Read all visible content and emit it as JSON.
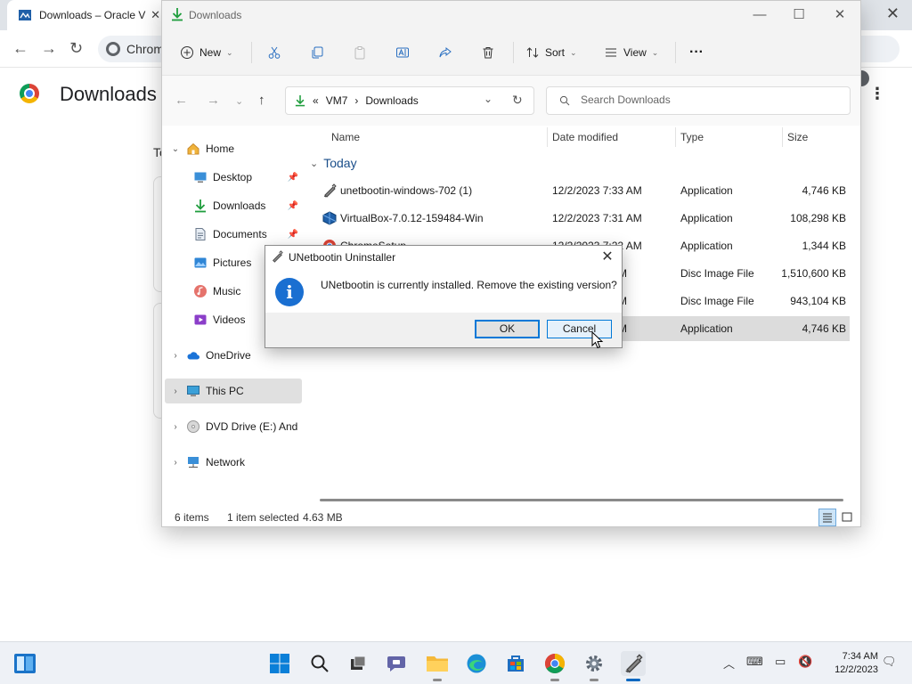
{
  "chrome": {
    "tab_title": "Downloads – Oracle V",
    "omnibox_text": "Chrom",
    "page_title": "Downloads",
    "partial_text": "To"
  },
  "explorer": {
    "title": "Downloads",
    "commands": {
      "new": "New",
      "sort": "Sort",
      "view": "View",
      "more": "···"
    },
    "address": {
      "overflow": "«",
      "crumbs": [
        "VM7",
        "Downloads"
      ],
      "sep": "›"
    },
    "search_placeholder": "Search Downloads",
    "nav": [
      {
        "label": "Home",
        "expand": "⌄"
      },
      {
        "label": "Desktop",
        "pinned": "📌"
      },
      {
        "label": "Downloads",
        "pinned": "📌"
      },
      {
        "label": "Documents",
        "pinned": "📌"
      },
      {
        "label": "Pictures",
        "pinned": "📌"
      },
      {
        "label": "Music"
      },
      {
        "label": "Videos"
      },
      {
        "label": "OneDrive",
        "expand": "›"
      },
      {
        "label": "This PC",
        "expand": "›"
      },
      {
        "label": "DVD Drive (E:) Andro",
        "expand": "›"
      },
      {
        "label": "Network",
        "expand": "›"
      }
    ],
    "columns": [
      "Name",
      "Date modified",
      "Type",
      "Size"
    ],
    "group": "Today",
    "files": [
      {
        "name": "unetbootin-windows-702 (1)",
        "date": "12/2/2023 7:33 AM",
        "type": "Application",
        "size": "4,746 KB"
      },
      {
        "name": "VirtualBox-7.0.12-159484-Win",
        "date": "12/2/2023 7:31 AM",
        "type": "Application",
        "size": "108,298 KB"
      },
      {
        "name": "ChromeSetup",
        "date": "12/2/2023 7:22 AM",
        "type": "Application",
        "size": "1,344 KB"
      },
      {
        "name": "",
        "date": "AM",
        "type": "Disc Image File",
        "size": "1,510,600 KB"
      },
      {
        "name": "",
        "date": "AM",
        "type": "Disc Image File",
        "size": "943,104 KB"
      },
      {
        "name": "",
        "date": "AM",
        "type": "Application",
        "size": "4,746 KB"
      }
    ],
    "status": {
      "count": "6 items",
      "selected": "1 item selected",
      "size": "4.63 MB"
    }
  },
  "dialog": {
    "title": "UNetbootin Uninstaller",
    "message": "UNetbootin is currently installed. Remove the existing version?",
    "ok": "OK",
    "cancel": "Cancel"
  },
  "taskbar": {
    "time": "7:34 AM",
    "date": "12/2/2023"
  }
}
